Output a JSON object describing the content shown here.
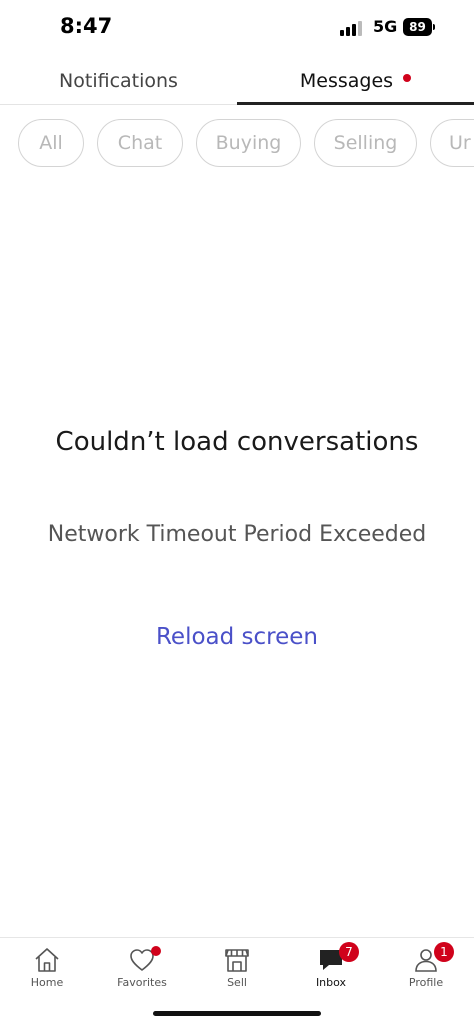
{
  "status_bar": {
    "time": "8:47",
    "network": "5G",
    "battery": "89"
  },
  "tabs": [
    {
      "label": "Notifications",
      "active": false
    },
    {
      "label": "Messages",
      "active": true,
      "has_dot": true
    }
  ],
  "filters": [
    {
      "label": "All"
    },
    {
      "label": "Chat"
    },
    {
      "label": "Buying"
    },
    {
      "label": "Selling"
    },
    {
      "label": "Ur"
    }
  ],
  "empty_state": {
    "title": "Couldn’t load conversations",
    "message": "Network Timeout Period Exceeded",
    "action": "Reload screen"
  },
  "bottom_nav": [
    {
      "label": "Home",
      "icon": "home-icon"
    },
    {
      "label": "Favorites",
      "icon": "heart-icon",
      "dot": true
    },
    {
      "label": "Sell",
      "icon": "storefront-icon"
    },
    {
      "label": "Inbox",
      "icon": "chat-bubble-icon",
      "badge": "7",
      "active": true
    },
    {
      "label": "Profile",
      "icon": "person-icon",
      "badge": "1"
    }
  ],
  "colors": {
    "accent": "#4a50c8",
    "badge": "#d0021b",
    "chip_border": "#d4d4d4"
  }
}
